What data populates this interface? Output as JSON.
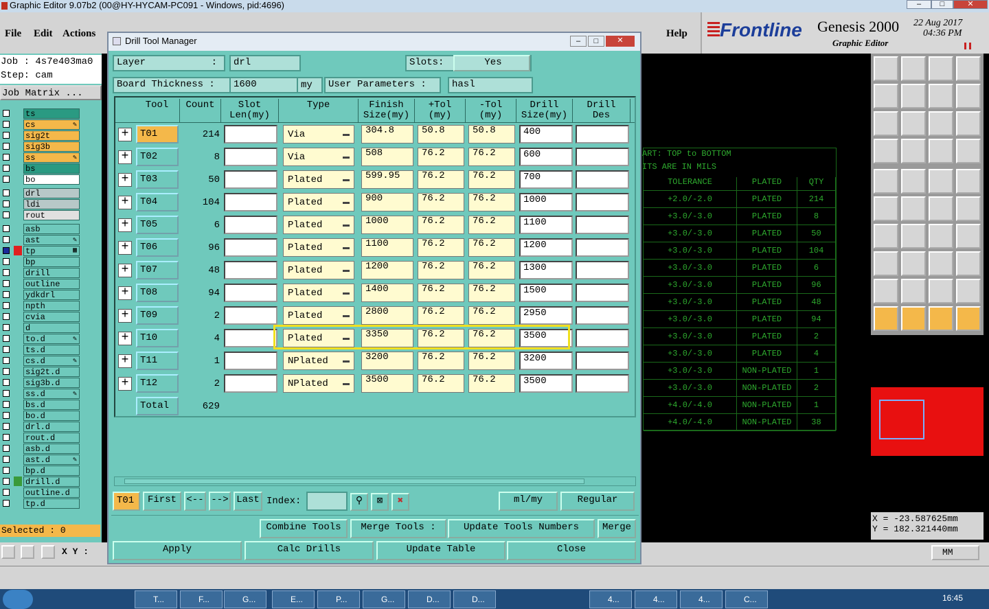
{
  "window": {
    "title": "Graphic Editor 9.07b2 (00@HY-HYCAM-PC091 - Windows, pid:4696)"
  },
  "menu": [
    "File",
    "Edit",
    "Actions"
  ],
  "help": "Help",
  "brand": {
    "logo": "Frontline",
    "product": "Genesis 2000",
    "subtitle": "Graphic Editor",
    "date": "22 Aug 2017",
    "time": "04:36 PM"
  },
  "left": {
    "job": "Job : 4s7e403ma0",
    "step": "Step: cam",
    "job_matrix": "Job Matrix ...",
    "selected": "Selected : 0",
    "layers": [
      {
        "name": "ts",
        "color": "#2a9a82",
        "icon": ""
      },
      {
        "name": "cs",
        "color": "#f4b84a",
        "icon": "pen"
      },
      {
        "name": "sig2t",
        "color": "#f4b84a",
        "icon": ""
      },
      {
        "name": "sig3b",
        "color": "#f4b84a",
        "icon": ""
      },
      {
        "name": "ss",
        "color": "#f4b84a",
        "icon": "pen"
      },
      {
        "name": "bs",
        "color": "#2a9a82",
        "icon": ""
      },
      {
        "name": "bo",
        "color": "#ffffff",
        "icon": ""
      },
      {
        "name": "drl",
        "color": "#b8c8c8",
        "icon": ""
      },
      {
        "name": "ldi",
        "color": "#b8c8c8",
        "icon": ""
      },
      {
        "name": "rout",
        "color": "#e0e0e0",
        "icon": ""
      },
      {
        "name": "asb",
        "color": "#6fc9bc",
        "icon": ""
      },
      {
        "name": "ast",
        "color": "#6fc9bc",
        "icon": "pen"
      },
      {
        "name": "tp",
        "color": "#6fc9bc",
        "icon": "grid"
      },
      {
        "name": "bp",
        "color": "#6fc9bc",
        "icon": ""
      },
      {
        "name": "drill",
        "color": "#6fc9bc",
        "icon": ""
      },
      {
        "name": "outline",
        "color": "#6fc9bc",
        "icon": ""
      },
      {
        "name": "ydkdrl",
        "color": "#6fc9bc",
        "icon": ""
      },
      {
        "name": "npth",
        "color": "#6fc9bc",
        "icon": ""
      },
      {
        "name": "cvia",
        "color": "#6fc9bc",
        "icon": ""
      },
      {
        "name": "d",
        "color": "#6fc9bc",
        "icon": ""
      },
      {
        "name": "to.d",
        "color": "#6fc9bc",
        "icon": "pen"
      },
      {
        "name": "ts.d",
        "color": "#6fc9bc",
        "icon": ""
      },
      {
        "name": "cs.d",
        "color": "#6fc9bc",
        "icon": "pen"
      },
      {
        "name": "sig2t.d",
        "color": "#6fc9bc",
        "icon": ""
      },
      {
        "name": "sig3b.d",
        "color": "#6fc9bc",
        "icon": ""
      },
      {
        "name": "ss.d",
        "color": "#6fc9bc",
        "icon": "pen"
      },
      {
        "name": "bs.d",
        "color": "#6fc9bc",
        "icon": ""
      },
      {
        "name": "bo.d",
        "color": "#6fc9bc",
        "icon": ""
      },
      {
        "name": "drl.d",
        "color": "#6fc9bc",
        "icon": ""
      },
      {
        "name": "rout.d",
        "color": "#6fc9bc",
        "icon": ""
      },
      {
        "name": "asb.d",
        "color": "#6fc9bc",
        "icon": ""
      },
      {
        "name": "ast.d",
        "color": "#6fc9bc",
        "icon": "pen"
      },
      {
        "name": "bp.d",
        "color": "#6fc9bc",
        "icon": ""
      },
      {
        "name": "drill.d",
        "color": "#6fc9bc",
        "icon": ""
      },
      {
        "name": "outline.d",
        "color": "#6fc9bc",
        "icon": ""
      },
      {
        "name": "tp.d",
        "color": "#6fc9bc",
        "icon": ""
      }
    ]
  },
  "dialog": {
    "title": "Drill Tool Manager",
    "layer_label": "Layer",
    "colon": ":",
    "layer_value": "drl",
    "slots_label": "Slots:",
    "slots_value": "Yes",
    "board_thickness_label": "Board Thickness :",
    "board_thickness_value": "1600",
    "unit_my": "my",
    "user_params_label": "User Parameters :",
    "user_params_value": "hasl",
    "columns": [
      "Tool",
      "Count",
      "Slot\nLen(my)",
      "Type",
      "Finish\nSize(my)",
      "+Tol\n(my)",
      "-Tol\n(my)",
      "Drill\nSize(my)",
      "Drill\nDes"
    ],
    "rows": [
      {
        "tool": "T01",
        "count": "214",
        "type": "Via",
        "finish": "304.8",
        "ptol": "50.8",
        "mtol": "50.8",
        "drill": "400"
      },
      {
        "tool": "T02",
        "count": "8",
        "type": "Via",
        "finish": "508",
        "ptol": "76.2",
        "mtol": "76.2",
        "drill": "600"
      },
      {
        "tool": "T03",
        "count": "50",
        "type": "Plated",
        "finish": "599.95",
        "ptol": "76.2",
        "mtol": "76.2",
        "drill": "700"
      },
      {
        "tool": "T04",
        "count": "104",
        "type": "Plated",
        "finish": "900",
        "ptol": "76.2",
        "mtol": "76.2",
        "drill": "1000"
      },
      {
        "tool": "T05",
        "count": "6",
        "type": "Plated",
        "finish": "1000",
        "ptol": "76.2",
        "mtol": "76.2",
        "drill": "1100"
      },
      {
        "tool": "T06",
        "count": "96",
        "type": "Plated",
        "finish": "1100",
        "ptol": "76.2",
        "mtol": "76.2",
        "drill": "1200"
      },
      {
        "tool": "T07",
        "count": "48",
        "type": "Plated",
        "finish": "1200",
        "ptol": "76.2",
        "mtol": "76.2",
        "drill": "1300"
      },
      {
        "tool": "T08",
        "count": "94",
        "type": "Plated",
        "finish": "1400",
        "ptol": "76.2",
        "mtol": "76.2",
        "drill": "1500"
      },
      {
        "tool": "T09",
        "count": "2",
        "type": "Plated",
        "finish": "2800",
        "ptol": "76.2",
        "mtol": "76.2",
        "drill": "2950"
      },
      {
        "tool": "T10",
        "count": "4",
        "type": "Plated",
        "finish": "3350",
        "ptol": "76.2",
        "mtol": "76.2",
        "drill": "3500"
      },
      {
        "tool": "T11",
        "count": "1",
        "type": "NPlated",
        "finish": "3200",
        "ptol": "76.2",
        "mtol": "76.2",
        "drill": "3200"
      },
      {
        "tool": "T12",
        "count": "2",
        "type": "NPlated",
        "finish": "3500",
        "ptol": "76.2",
        "mtol": "76.2",
        "drill": "3500"
      }
    ],
    "total_label": "Total",
    "total_value": "629",
    "nav": {
      "current": "T01",
      "first": "First",
      "prev": "<--",
      "next": "-->",
      "last": "Last",
      "index": "Index:",
      "units": "ml/my",
      "mode": "Regular"
    },
    "actions": {
      "combine": "Combine Tools",
      "merge_tools": "Merge Tools :",
      "update_numbers": "Update Tools Numbers",
      "merge": "Merge"
    },
    "buttons": {
      "apply": "Apply",
      "calc": "Calc Drills",
      "update": "Update Table",
      "close": "Close"
    }
  },
  "right_table": {
    "line1": "ART: TOP to BOTTOM",
    "line2": "ITS ARE IN MILS",
    "headers": [
      "TOLERANCE",
      "PLATED",
      "QTY"
    ],
    "rows": [
      [
        "+2.0/-2.0",
        "PLATED",
        "214"
      ],
      [
        "+3.0/-3.0",
        "PLATED",
        "8"
      ],
      [
        "+3.0/-3.0",
        "PLATED",
        "50"
      ],
      [
        "+3.0/-3.0",
        "PLATED",
        "104"
      ],
      [
        "+3.0/-3.0",
        "PLATED",
        "6"
      ],
      [
        "+3.0/-3.0",
        "PLATED",
        "96"
      ],
      [
        "+3.0/-3.0",
        "PLATED",
        "48"
      ],
      [
        "+3.0/-3.0",
        "PLATED",
        "94"
      ],
      [
        "+3.0/-3.0",
        "PLATED",
        "2"
      ],
      [
        "+3.0/-3.0",
        "PLATED",
        "4"
      ],
      [
        "+3.0/-3.0",
        "NON-PLATED",
        "1"
      ],
      [
        "+3.0/-3.0",
        "NON-PLATED",
        "2"
      ],
      [
        "+4.0/-4.0",
        "NON-PLATED",
        "1"
      ],
      [
        "+4.0/-4.0",
        "NON-PLATED",
        "38"
      ]
    ]
  },
  "coords": {
    "x": "X = -23.587625mm",
    "y": "Y = 182.321440mm"
  },
  "statusbar": {
    "xy": "X Y :",
    "units": "MM"
  },
  "taskbar": {
    "items": [
      "T...",
      "F...",
      "G...",
      "E...",
      "P...",
      "G...",
      "D...",
      "D...",
      "4...",
      "4...",
      "4...",
      "C..."
    ],
    "clock": "16:45"
  },
  "colors": {
    "teal": "#6fc9bc",
    "highlight": "#f0e020",
    "orange": "#f4b84a"
  }
}
